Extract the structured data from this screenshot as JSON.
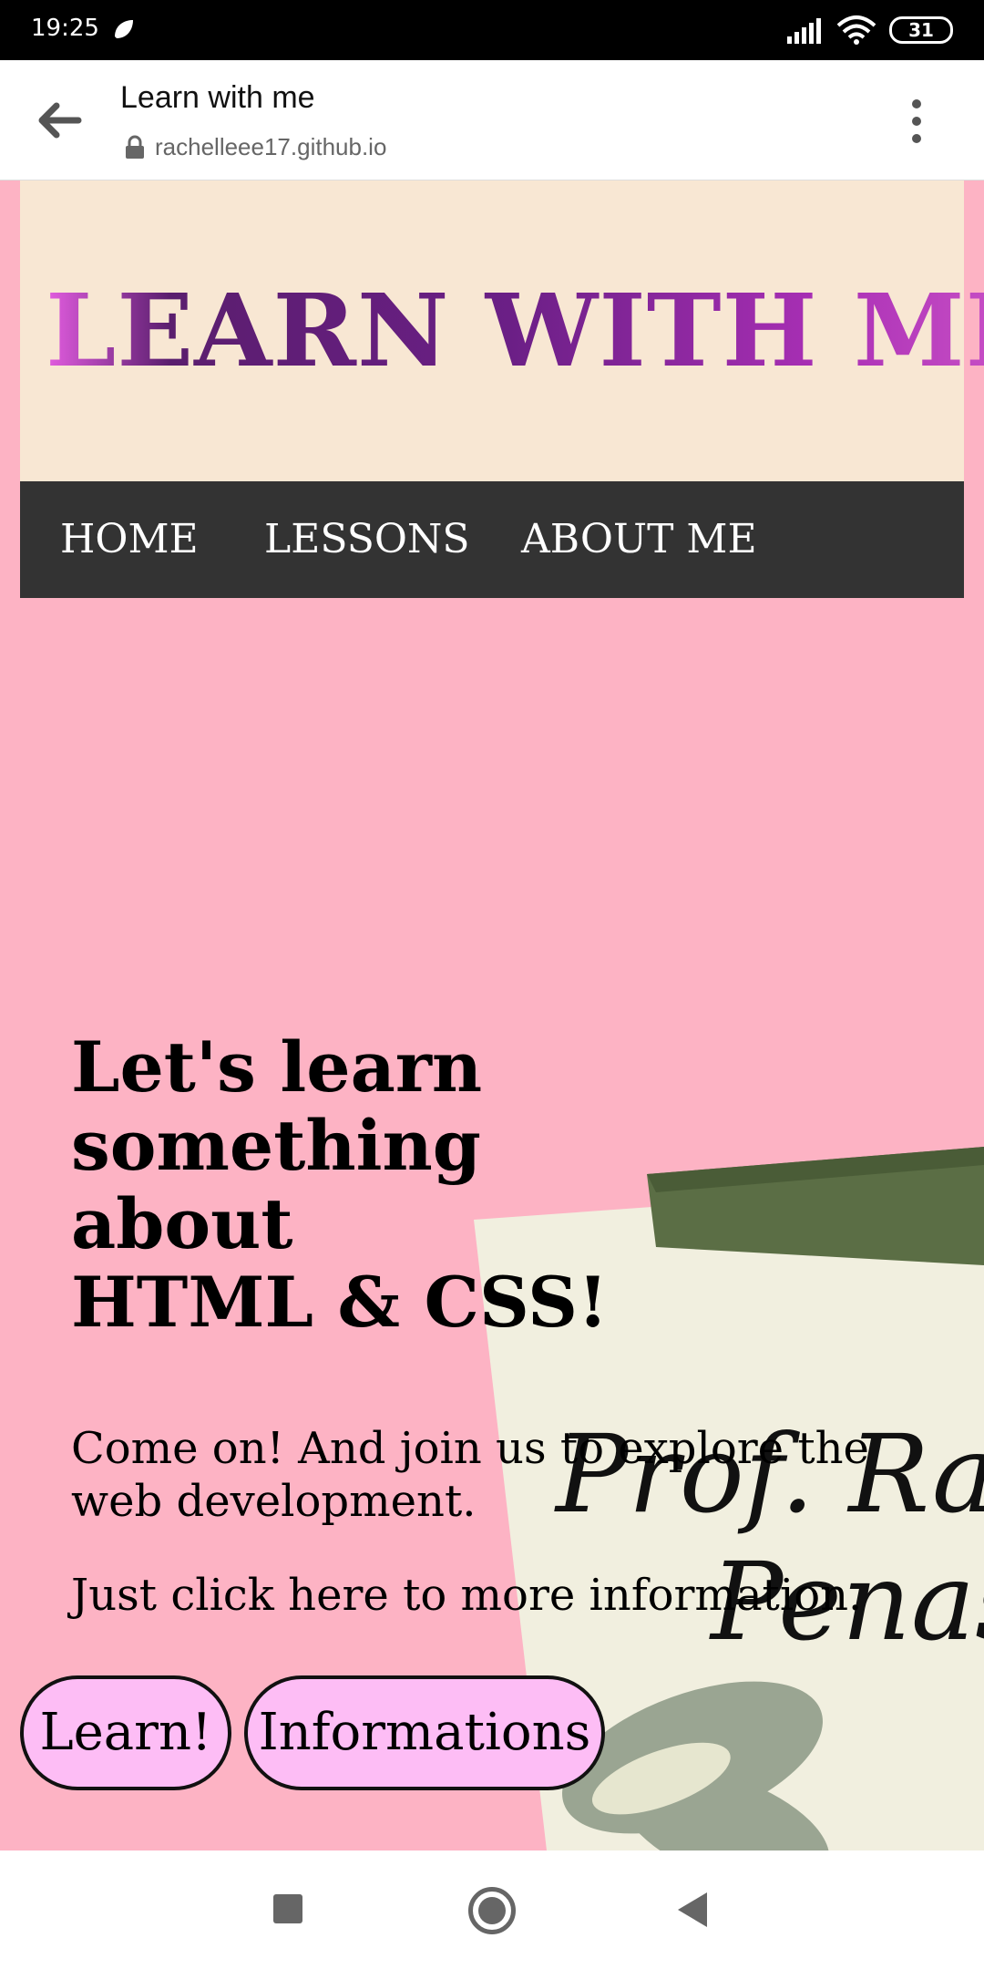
{
  "status_bar": {
    "time": "19:25",
    "battery": "31",
    "icons": [
      "notification-icon",
      "signal-icon",
      "wifi-icon",
      "battery-icon"
    ]
  },
  "browser": {
    "title": "Learn with me",
    "url": "rachelleee17.github.io",
    "icons": [
      "back-arrow-icon",
      "lock-icon",
      "more-menu-icon"
    ]
  },
  "site": {
    "title": "LEARN WITH ME.",
    "nav": [
      "HOME",
      "LESSONS",
      "ABOUT ME"
    ],
    "headline_line1": "Let's learn something",
    "headline_line2": "about",
    "headline_line3": "HTML & CSS!",
    "lead": "Come on! And join us to explore the web development.",
    "lead2": "Just click here to more information.",
    "buttons": {
      "learn": "Learn!",
      "info": "Informations"
    },
    "collage": {
      "line1": "Prof. Ra",
      "line2": "Penas"
    }
  },
  "colors": {
    "page_bg": "#fdb3c4",
    "header_bg": "#f8e7d3",
    "nav_bg": "#333333",
    "button_bg": "#fdbdf5"
  },
  "system_nav": [
    "recent-apps-icon",
    "home-icon",
    "back-icon"
  ]
}
